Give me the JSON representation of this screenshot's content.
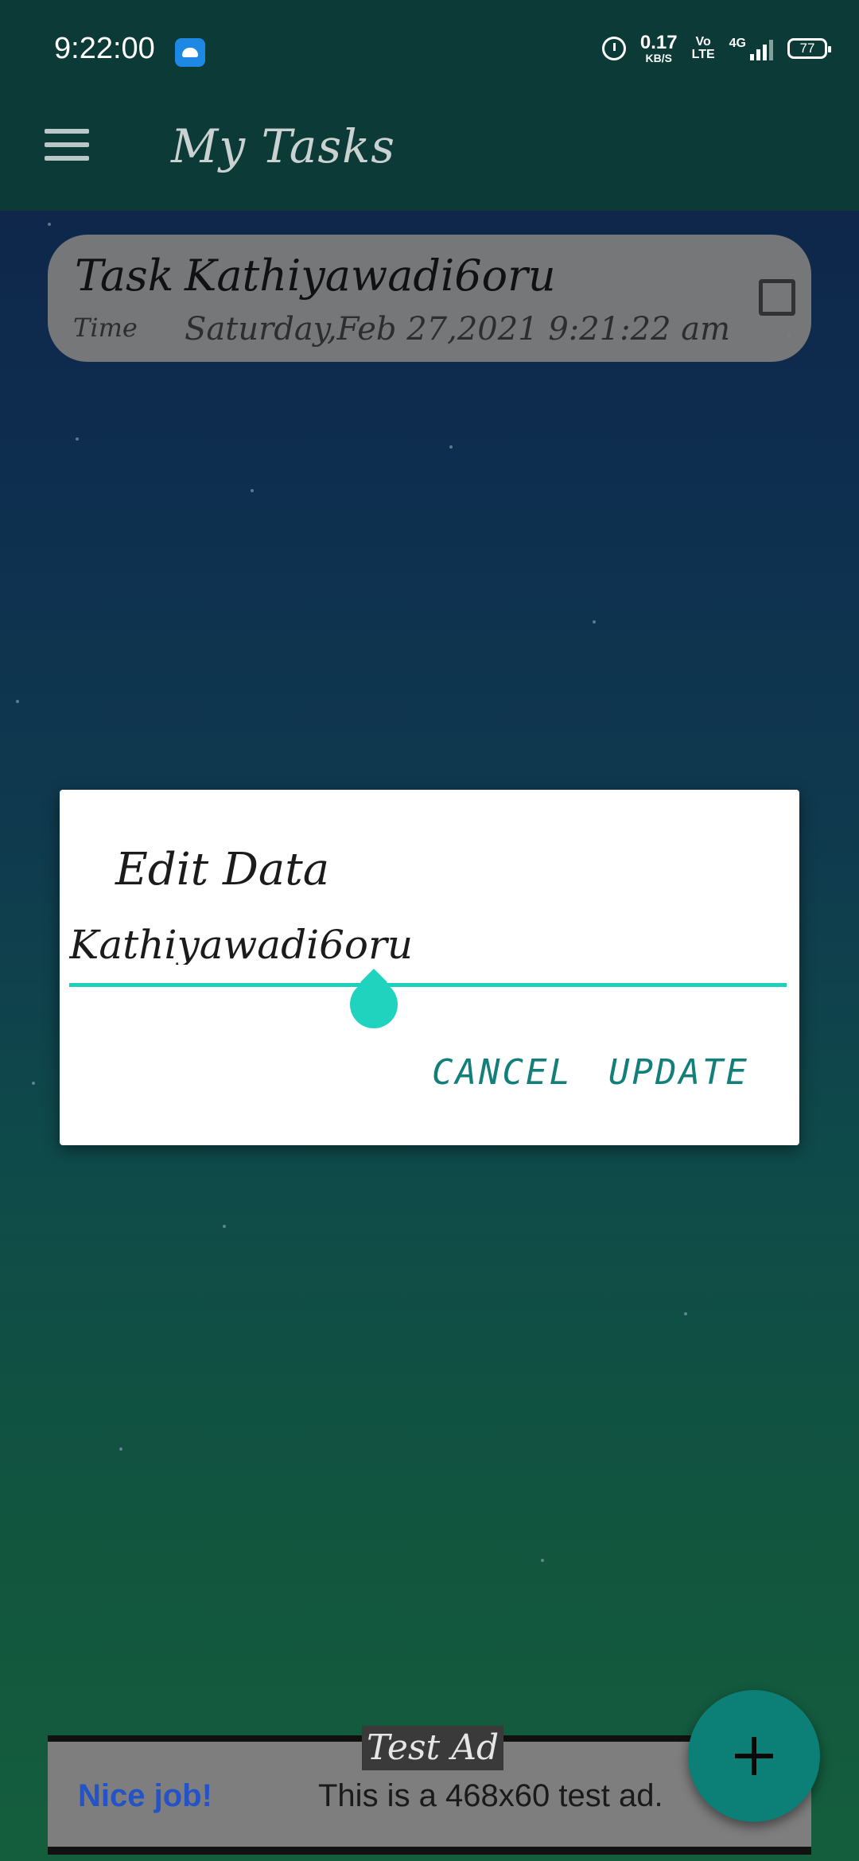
{
  "status_bar": {
    "time": "9:22:00",
    "net_speed": "0.17",
    "net_unit": "KB/S",
    "volte": "Vo\nLTE",
    "network": "4G",
    "battery": "77"
  },
  "appbar": {
    "title": "My Tasks"
  },
  "task": {
    "label": "Task",
    "name": "Kathiyawadi6oru",
    "time_label": "Time",
    "time_value": "Saturday,Feb 27,2021 9:21:22 am"
  },
  "dialog": {
    "title": "Edit Data",
    "input_value": "Kathiyawadi6oru",
    "cancel_label": "CANCEL",
    "update_label": "UPDATE"
  },
  "ad": {
    "label": "Test Ad",
    "nice": "Nice job!",
    "text": "This is a 468x60 test ad."
  },
  "colors": {
    "bar_bg": "#0b3a37",
    "accent": "#1fcfbd",
    "fab": "#0c7f76"
  }
}
